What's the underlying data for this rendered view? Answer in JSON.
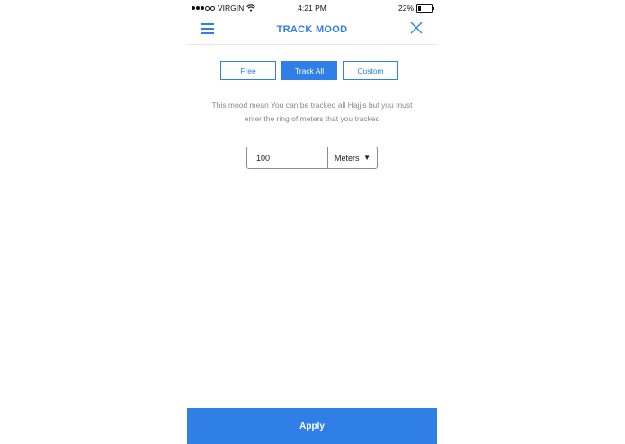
{
  "status_bar": {
    "carrier": "VIRGIN",
    "time": "4:21 PM",
    "battery": "22%",
    "battery_level": 0.22
  },
  "navbar": {
    "title": "TRACK MOOD"
  },
  "tabs": [
    {
      "label": "Free",
      "active": false
    },
    {
      "label": "Track All",
      "active": true
    },
    {
      "label": "Custom",
      "active": false
    }
  ],
  "description": "This mood mean You can be tracked all Hajjis but you must enter the ring of meters that you tracked",
  "range": {
    "value": "100",
    "unit": "Meters"
  },
  "apply_label": "Apply",
  "colors": {
    "accent": "#2f7fe6"
  }
}
